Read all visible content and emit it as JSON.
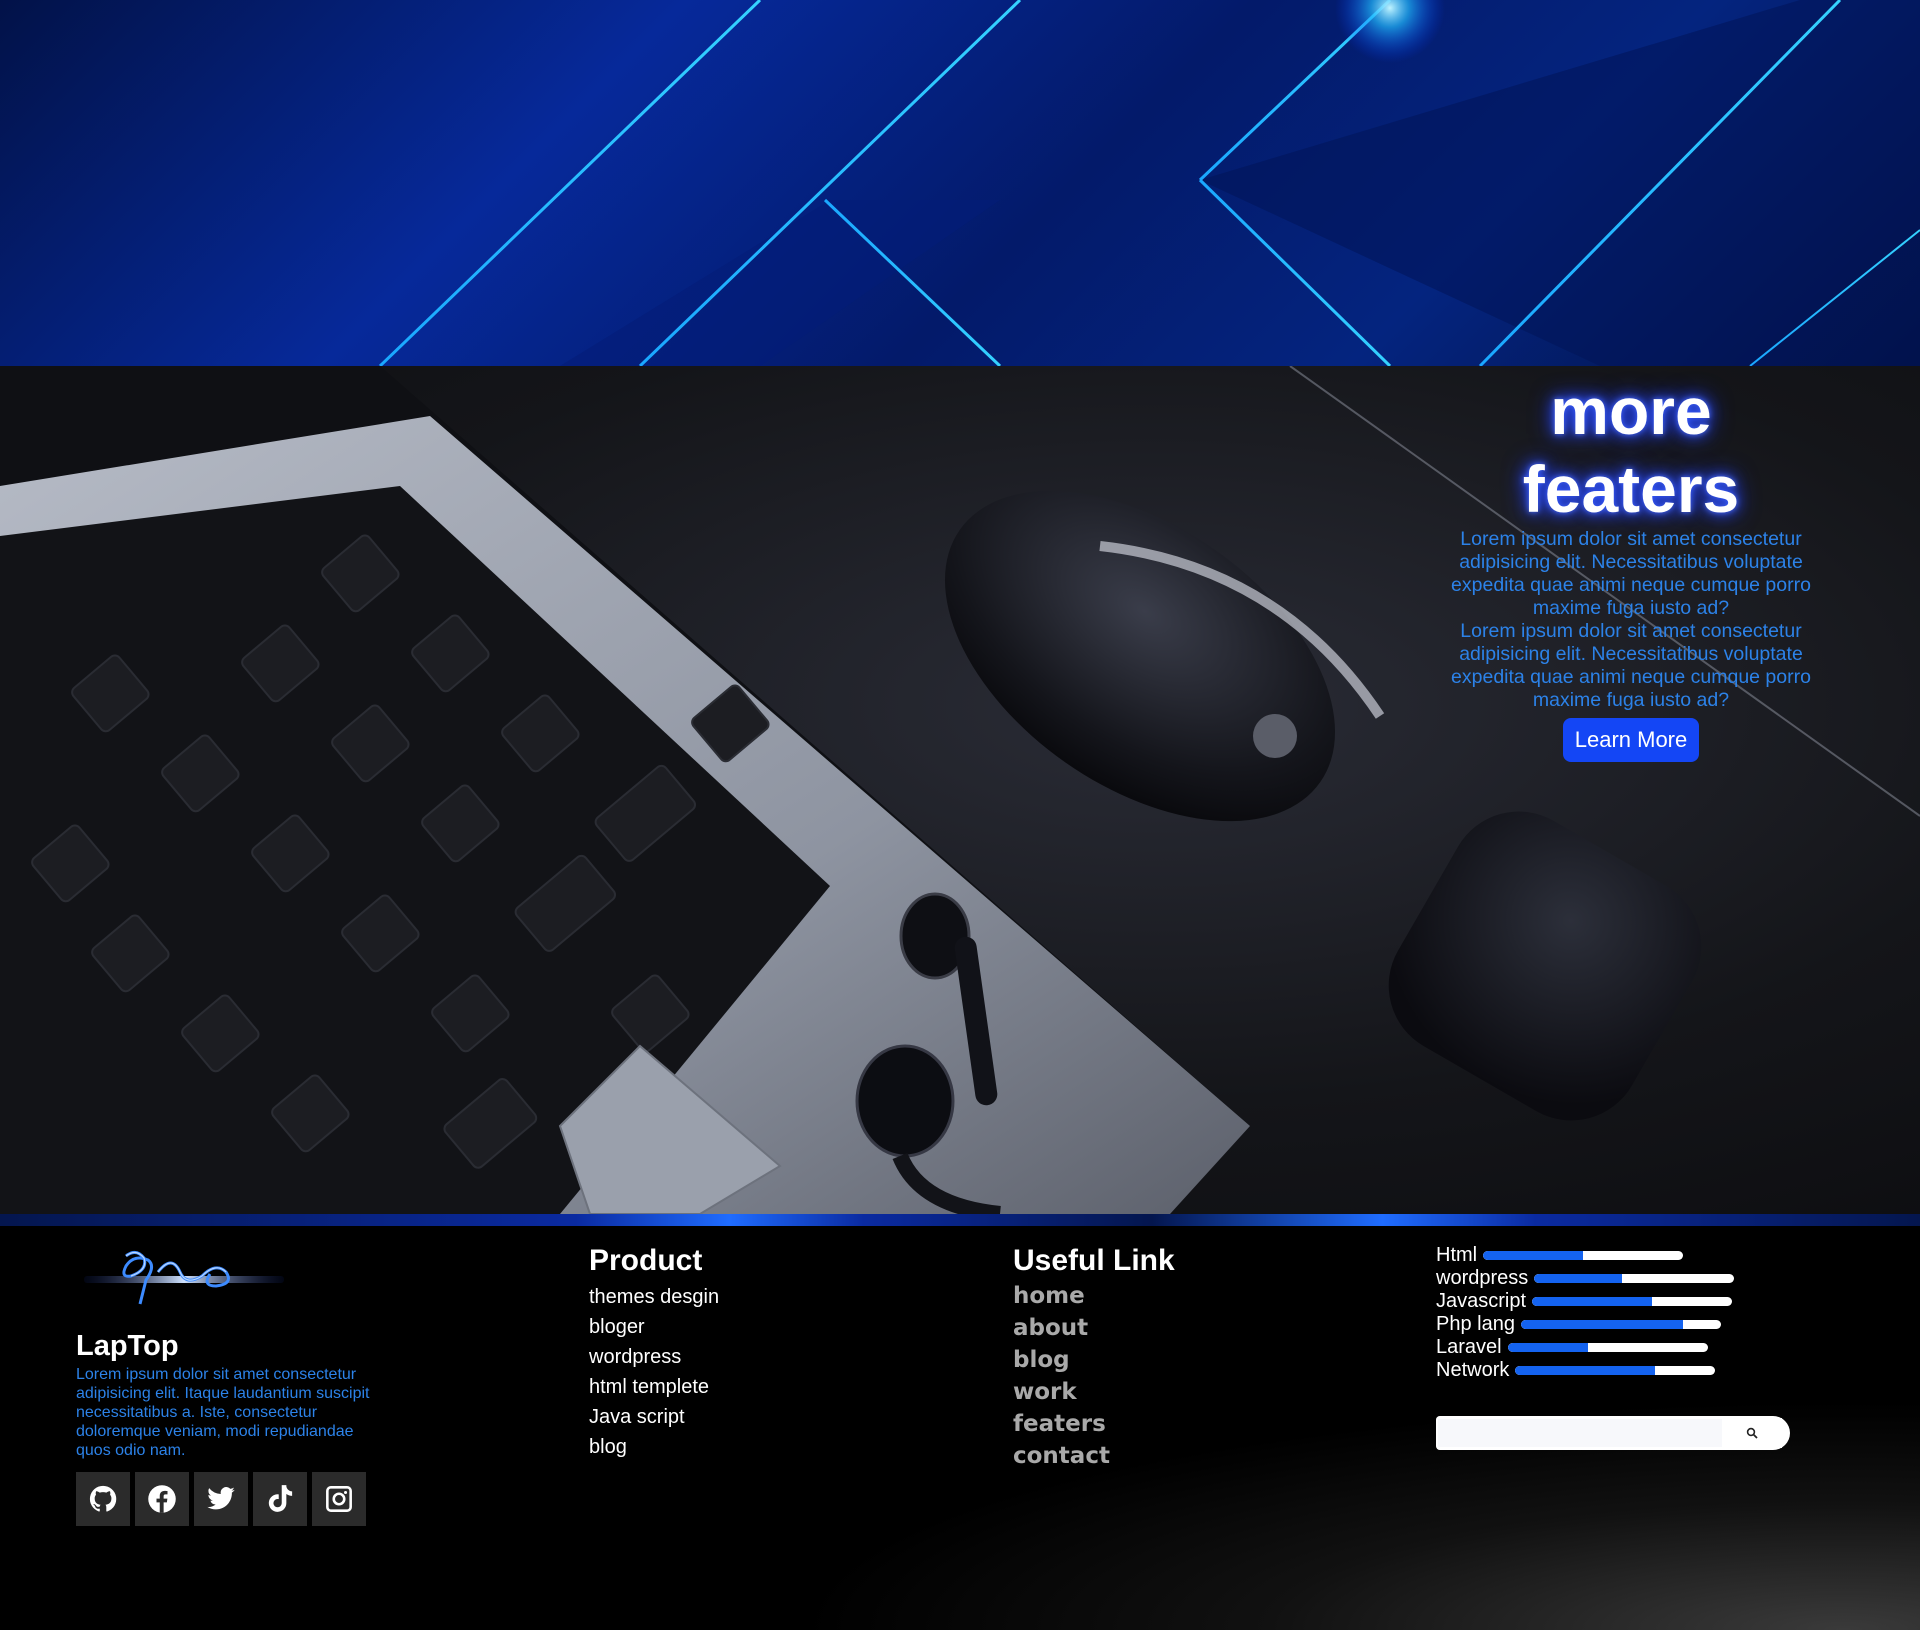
{
  "colors": {
    "accent_blue": "#1446f5",
    "link_blue": "#2c82e8",
    "skill_fill": "#1463f0",
    "footer_bg": "#000000",
    "useful_link_gray": "#a9a9a9"
  },
  "banner": {
    "decoration": "abstract blue glowing geometric lines"
  },
  "hero": {
    "image": "laptop keyboard, mouse and earbuds on dark desk",
    "title_line1": "more",
    "title_line2": "featers",
    "paragraph1": "Lorem ipsum dolor sit amet consectetur adipisicing elit. Necessitatibus voluptate expedita quae animi neque cumque porro maxime fuga iusto ad?",
    "paragraph2": "Lorem ipsum dolor sit amet consectetur adipisicing elit. Necessitatibus voluptate expedita quae animi neque cumque porro maxime fuga iusto ad?",
    "cta_label": "Learn More"
  },
  "footer": {
    "brand": {
      "name": "LapTop",
      "description": "Lorem ipsum dolor sit amet consectetur adipisicing elit. Itaque laudantium suscipit necessitatibus a. Iste, consectetur doloremque veniam, modi repudiandae quos odio nam.",
      "socials": [
        {
          "icon": "github-icon"
        },
        {
          "icon": "facebook-icon"
        },
        {
          "icon": "twitter-icon"
        },
        {
          "icon": "tiktok-icon"
        },
        {
          "icon": "instagram-icon"
        }
      ]
    },
    "product": {
      "heading": "Product",
      "items": [
        "themes desgin",
        "bloger",
        "wordpress",
        "html templete",
        "Java script",
        "blog"
      ]
    },
    "useful_link": {
      "heading": "Useful Link",
      "items": [
        "home",
        "about",
        "blog",
        "work",
        "featers",
        "contact"
      ]
    },
    "skills": [
      {
        "label": "Html",
        "percent": 50
      },
      {
        "label": "wordpress",
        "percent": 44
      },
      {
        "label": "Javascript",
        "percent": 60
      },
      {
        "label": "Php lang",
        "percent": 81
      },
      {
        "label": "Laravel",
        "percent": 40
      },
      {
        "label": "Network",
        "percent": 70
      }
    ],
    "search": {
      "placeholder": "",
      "button_icon": "search-icon"
    }
  }
}
